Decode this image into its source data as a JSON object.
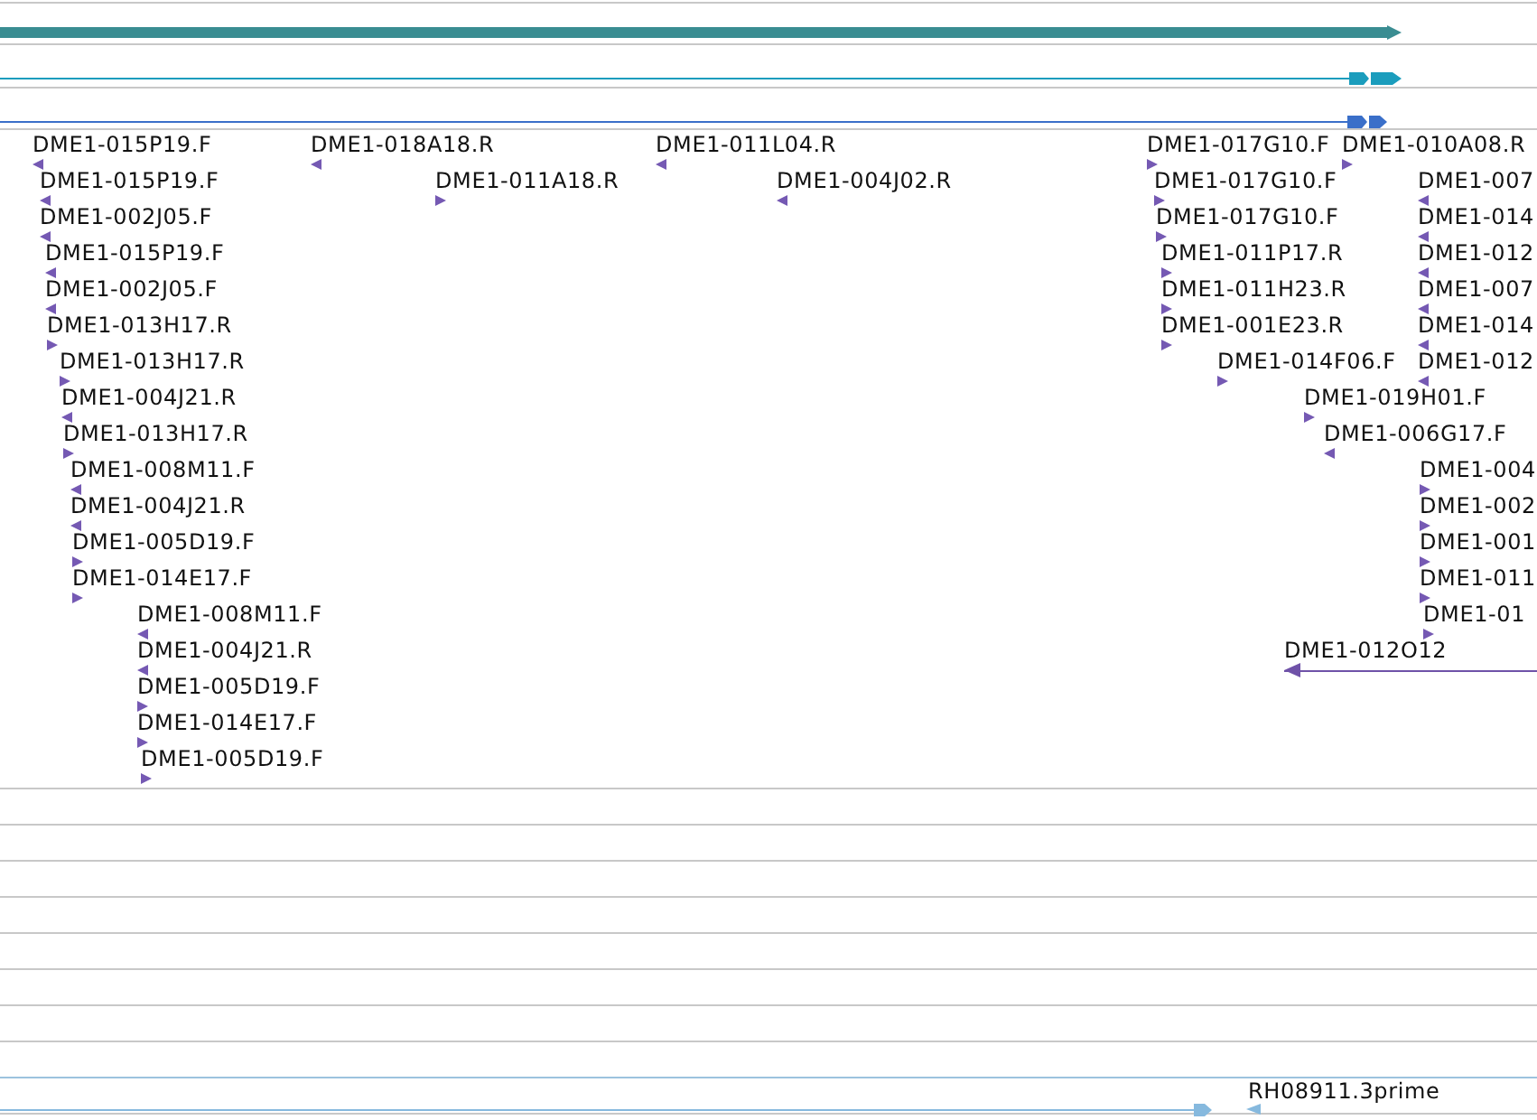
{
  "features": [
    {
      "label": "DME1-015P19.F",
      "reverse": true,
      "kind": "short"
    },
    {
      "label": "DME1-018A18.R",
      "reverse": true,
      "kind": "short"
    },
    {
      "label": "DME1-011L04.R",
      "reverse": true,
      "kind": "short"
    },
    {
      "label": "DME1-017G10.F",
      "reverse": false,
      "kind": "short"
    },
    {
      "label": "DME1-010A08.R",
      "reverse": false,
      "kind": "short"
    },
    {
      "label": "DME1-015P19.F",
      "reverse": true,
      "kind": "short"
    },
    {
      "label": "DME1-011A18.R",
      "reverse": false,
      "kind": "short"
    },
    {
      "label": "DME1-004J02.R",
      "reverse": true,
      "kind": "short"
    },
    {
      "label": "DME1-017G10.F",
      "reverse": false,
      "kind": "short"
    },
    {
      "label": "DME1-007",
      "reverse": true,
      "kind": "short"
    },
    {
      "label": "DME1-002J05.F",
      "reverse": true,
      "kind": "short"
    },
    {
      "label": "DME1-017G10.F",
      "reverse": false,
      "kind": "short"
    },
    {
      "label": "DME1-014",
      "reverse": true,
      "kind": "short"
    },
    {
      "label": "DME1-015P19.F",
      "reverse": true,
      "kind": "short"
    },
    {
      "label": "DME1-011P17.R",
      "reverse": false,
      "kind": "short"
    },
    {
      "label": "DME1-012",
      "reverse": true,
      "kind": "short"
    },
    {
      "label": "DME1-002J05.F",
      "reverse": true,
      "kind": "short"
    },
    {
      "label": "DME1-011H23.R",
      "reverse": false,
      "kind": "short"
    },
    {
      "label": "DME1-007",
      "reverse": true,
      "kind": "short"
    },
    {
      "label": "DME1-013H17.R",
      "reverse": false,
      "kind": "short"
    },
    {
      "label": "DME1-001E23.R",
      "reverse": false,
      "kind": "short"
    },
    {
      "label": "DME1-014",
      "reverse": true,
      "kind": "short"
    },
    {
      "label": "DME1-013H17.R",
      "reverse": false,
      "kind": "short"
    },
    {
      "label": "DME1-014F06.F",
      "reverse": false,
      "kind": "short"
    },
    {
      "label": "DME1-012",
      "reverse": true,
      "kind": "short"
    },
    {
      "label": "DME1-004J21.R",
      "reverse": true,
      "kind": "short"
    },
    {
      "label": "DME1-019H01.F",
      "reverse": false,
      "kind": "short"
    },
    {
      "label": "DME1-013H17.R",
      "reverse": false,
      "kind": "short"
    },
    {
      "label": "DME1-006G17.F",
      "reverse": true,
      "kind": "short"
    },
    {
      "label": "DME1-008M11.F",
      "reverse": true,
      "kind": "short"
    },
    {
      "label": "DME1-004",
      "reverse": false,
      "kind": "short"
    },
    {
      "label": "DME1-004J21.R",
      "reverse": true,
      "kind": "short"
    },
    {
      "label": "DME1-002",
      "reverse": false,
      "kind": "short"
    },
    {
      "label": "DME1-005D19.F",
      "reverse": false,
      "kind": "short"
    },
    {
      "label": "DME1-001",
      "reverse": false,
      "kind": "short"
    },
    {
      "label": "DME1-014E17.F",
      "reverse": false,
      "kind": "short"
    },
    {
      "label": "DME1-011",
      "reverse": false,
      "kind": "short"
    },
    {
      "label": "DME1-008M11.F",
      "reverse": true,
      "kind": "short"
    },
    {
      "label": "DME1-01",
      "reverse": false,
      "kind": "short"
    },
    {
      "label": "DME1-004J21.R",
      "reverse": true,
      "kind": "short"
    },
    {
      "label": "DME1-012O12",
      "reverse": true,
      "kind": "long"
    },
    {
      "label": "DME1-005D19.F",
      "reverse": false,
      "kind": "short"
    },
    {
      "label": "DME1-014E17.F",
      "reverse": false,
      "kind": "short"
    },
    {
      "label": "DME1-005D19.F",
      "reverse": false,
      "kind": "short"
    }
  ],
  "est": {
    "label": "RH08911.3prime",
    "reverse": true
  }
}
